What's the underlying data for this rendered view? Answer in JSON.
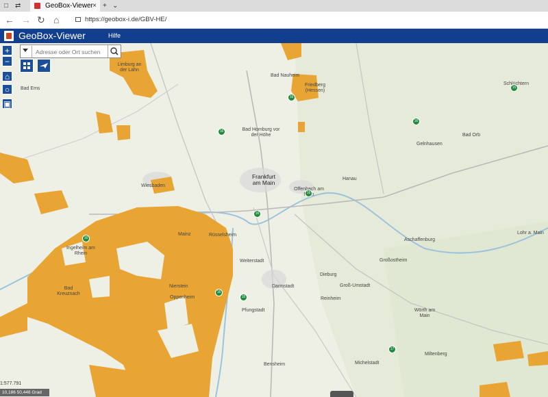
{
  "browser": {
    "tab_title": "GeoBox-Viewer",
    "url": "https://geobox-i.de/GBV-HE/"
  },
  "app": {
    "title": "GeoBox-Viewer",
    "menu_help": "Hilfe"
  },
  "search": {
    "placeholder": "Adresse oder Ort suchen"
  },
  "map": {
    "scale": "1:577.791",
    "coordinates": "10,186 50,448 Grad",
    "colors": {
      "overlay": "#e8a533",
      "marker": "#1f8a3c",
      "appbar": "#123e8e"
    },
    "labels": [
      "Bad Ems",
      "Bad Nauheim",
      "Friedberg (Hessen)",
      "Schlüchtern",
      "Bad Homburg vor der Höhe",
      "Gelnhausen",
      "Bad Orb",
      "Frankfurt am Main",
      "Hanau",
      "Offenbach am Main",
      "Wiesbaden",
      "Mainz",
      "Rüsselsheim",
      "Aschaffenburg",
      "Lohr a. Main",
      "Darmstadt",
      "Dieburg",
      "Groß-Umstadt",
      "Großostheim",
      "Bad Kreuznach",
      "Pfungstadt",
      "Reinheim",
      "Wörth am Main",
      "Michelstadt",
      "Miltenberg",
      "Bensheim",
      "Ingelheim am Rhein",
      "Limburg an der Lahn",
      "Weiterstadt",
      "Nierstein",
      "Oppenheim"
    ],
    "markers": [
      "16",
      "15",
      "16",
      "16",
      "16",
      "16",
      "16",
      "17",
      "16",
      "15"
    ]
  }
}
